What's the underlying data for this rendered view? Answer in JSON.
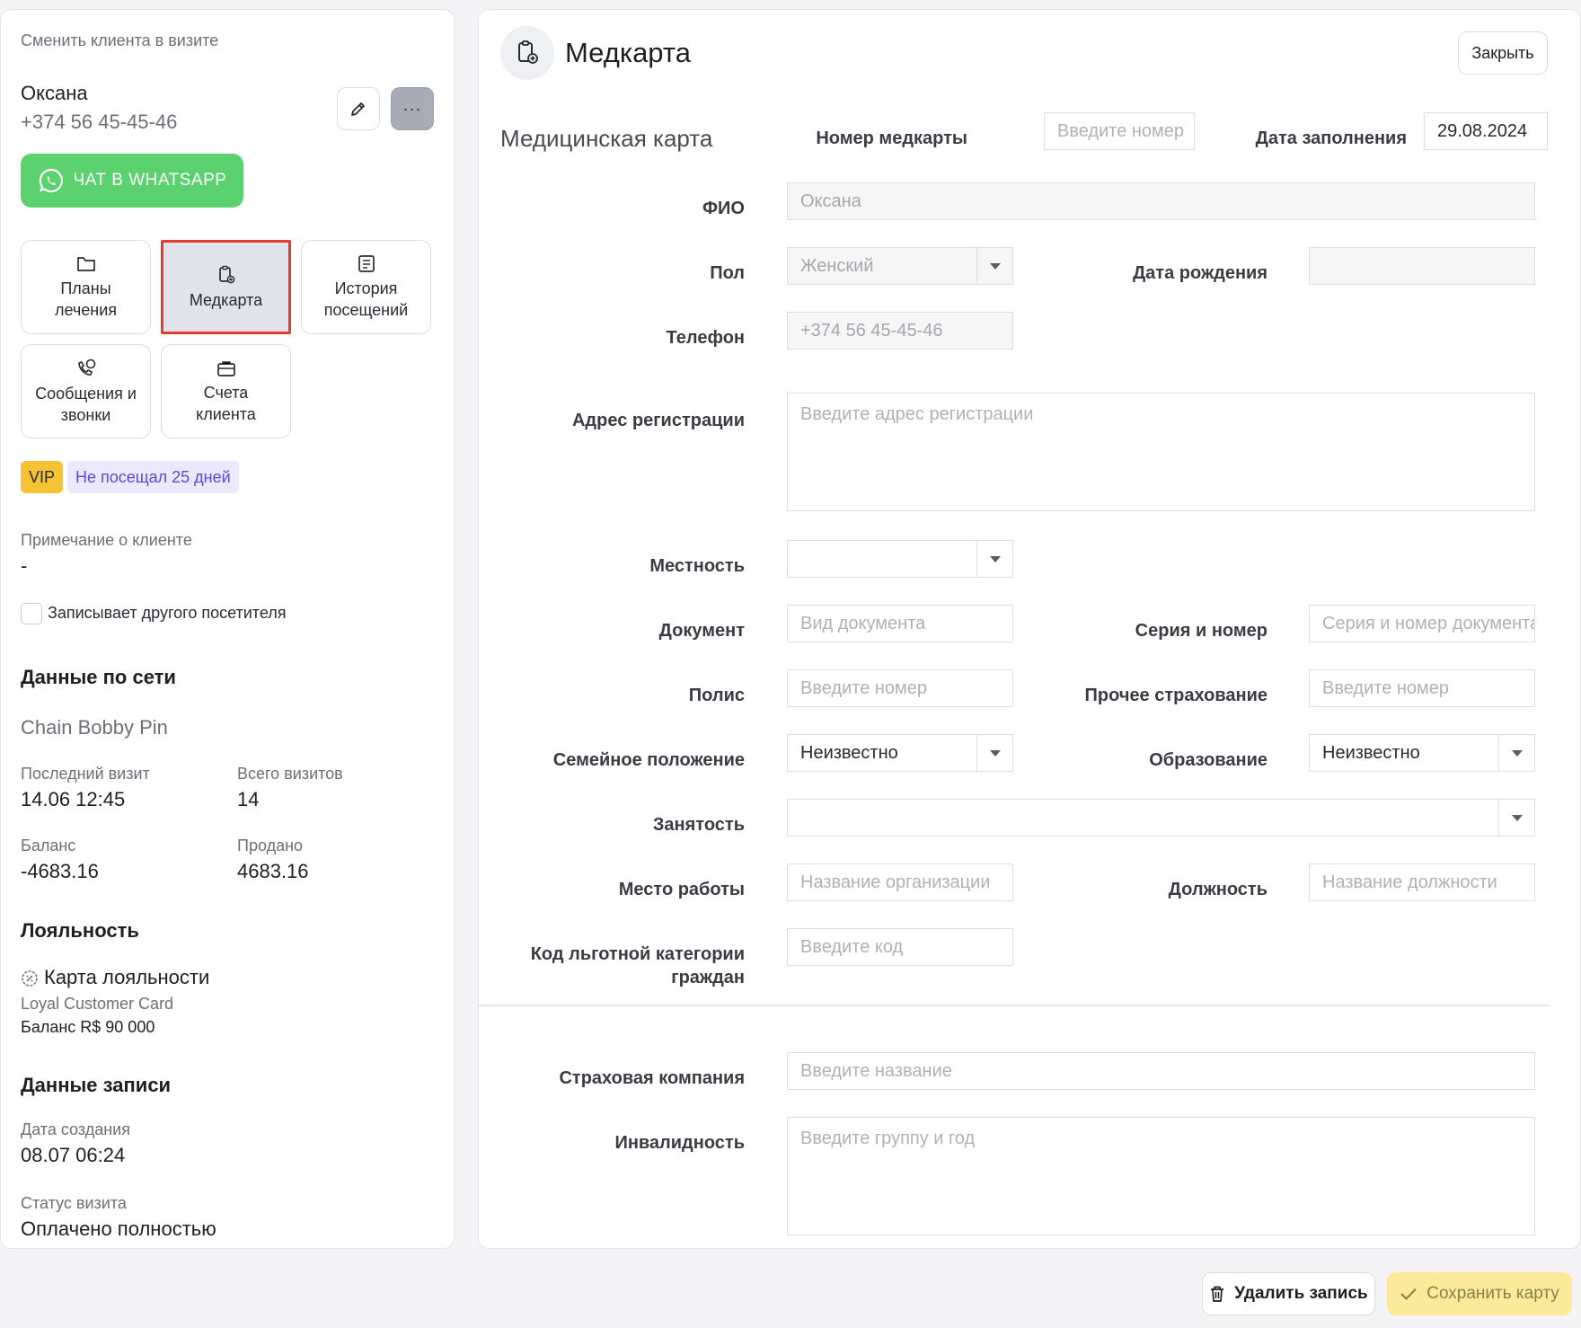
{
  "client_panel": {
    "change_client_label": "Сменить клиента в визите",
    "client_name": "Оксана",
    "client_phone": "+374 56 45-45-46",
    "more_label": "···",
    "whatsapp_label": "ЧАТ В WHATSAPP",
    "tiles": [
      {
        "label": "Планы лечения",
        "icon": "folder-icon"
      },
      {
        "label": "Медкарта",
        "icon": "medcard-icon",
        "active": true
      },
      {
        "label": "История посещений",
        "icon": "history-icon"
      },
      {
        "label": "Сообщения и звонки",
        "icon": "phone-chat-icon"
      },
      {
        "label": "Счета клиента",
        "icon": "wallet-icon"
      }
    ],
    "badges": {
      "vip": "VIP",
      "visits": "Не посещал 25 дней"
    },
    "note_label": "Примечание о клиенте",
    "note_value": "-",
    "other_visitor_label": "Записывает другого посетителя",
    "network": {
      "title": "Данные по сети",
      "chain_name": "Chain Bobby Pin",
      "last_visit_label": "Последний визит",
      "last_visit_value": "14.06 12:45",
      "total_visits_label": "Всего визитов",
      "total_visits_value": "14",
      "balance_label": "Баланс",
      "balance_value": "-4683.16",
      "sold_label": "Продано",
      "sold_value": "4683.16"
    },
    "loyalty": {
      "title": "Лояльность",
      "card_title": "Карта лояльности",
      "card_name": "Loyal Customer Card",
      "card_balance": "Баланс R$ 90 000"
    },
    "record": {
      "title": "Данные записи",
      "created_label": "Дата создания",
      "created_value": "08.07 06:24",
      "status_label": "Статус визита",
      "status_value": "Оплачено полностью"
    }
  },
  "medcard": {
    "title": "Медкарта",
    "close_label": "Закрыть",
    "subtitle": "Медицинская карта",
    "card_number_label": "Номер медкарты",
    "card_number_placeholder": "Введите номер",
    "fill_date_label": "Дата заполнения",
    "fill_date_value": "29.08.2024",
    "fio_label": "ФИО",
    "fio_value": "Оксана",
    "gender_label": "Пол",
    "gender_value": "Женский",
    "birthdate_label": "Дата рождения",
    "phone_label": "Телефон",
    "phone_value": "+374 56 45-45-46",
    "address_label": "Адрес регистрации",
    "address_placeholder": "Введите адрес регистрации",
    "locality_label": "Местность",
    "document_label": "Документ",
    "document_placeholder": "Вид документа",
    "series_label": "Серия и номер",
    "series_placeholder": "Серия и номер документа",
    "policy_label": "Полис",
    "policy_placeholder": "Введите номер",
    "other_insurance_label": "Прочее страхование",
    "other_insurance_placeholder": "Введите номер",
    "marital_label": "Семейное положение",
    "marital_value": "Неизвестно",
    "education_label": "Образование",
    "education_value": "Неизвестно",
    "employment_label": "Занятость",
    "workplace_label": "Место работы",
    "workplace_placeholder": "Название организации",
    "position_label": "Должность",
    "position_placeholder": "Название должности",
    "benefit_code_label_1": "Код льготной категории",
    "benefit_code_label_2": "граждан",
    "benefit_code_placeholder": "Введите код",
    "insurance_company_label": "Страховая компания",
    "insurance_company_placeholder": "Введите название",
    "disability_label": "Инвалидность",
    "disability_placeholder": "Введите группу и год"
  },
  "footer": {
    "delete_label": "Удалить запись",
    "save_label": "Сохранить карту"
  },
  "colors": {
    "whatsapp": "#5cd16f",
    "vip_badge": "#f4c233",
    "visits_badge_bg": "#ebe8ff",
    "visits_badge_text": "#5a4bd6",
    "active_tile_border": "#e53b2f",
    "save_button": "#faea9a"
  }
}
